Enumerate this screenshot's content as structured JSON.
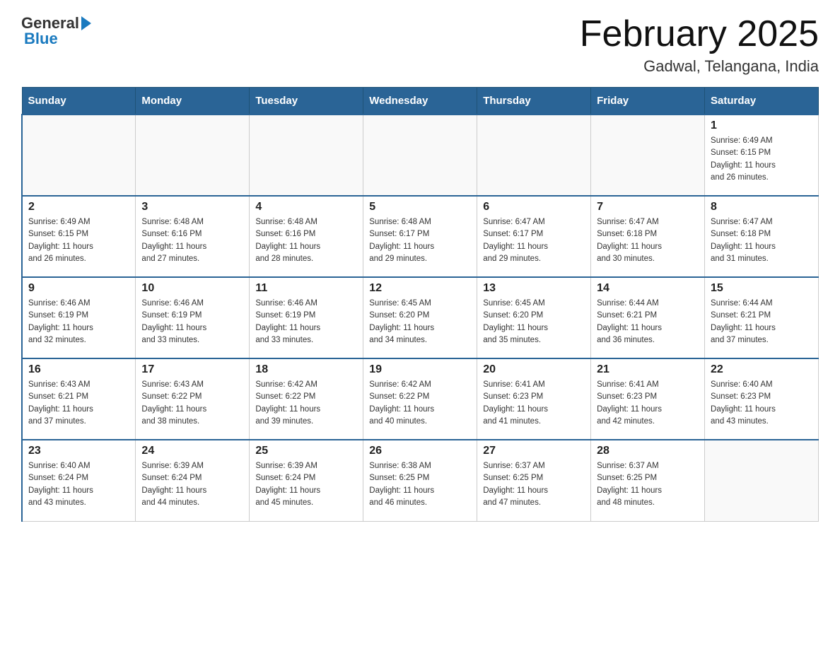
{
  "header": {
    "logo_general": "General",
    "logo_blue": "Blue",
    "month_title": "February 2025",
    "location": "Gadwal, Telangana, India"
  },
  "weekdays": [
    "Sunday",
    "Monday",
    "Tuesday",
    "Wednesday",
    "Thursday",
    "Friday",
    "Saturday"
  ],
  "weeks": [
    [
      {
        "day": "",
        "info": ""
      },
      {
        "day": "",
        "info": ""
      },
      {
        "day": "",
        "info": ""
      },
      {
        "day": "",
        "info": ""
      },
      {
        "day": "",
        "info": ""
      },
      {
        "day": "",
        "info": ""
      },
      {
        "day": "1",
        "info": "Sunrise: 6:49 AM\nSunset: 6:15 PM\nDaylight: 11 hours\nand 26 minutes."
      }
    ],
    [
      {
        "day": "2",
        "info": "Sunrise: 6:49 AM\nSunset: 6:15 PM\nDaylight: 11 hours\nand 26 minutes."
      },
      {
        "day": "3",
        "info": "Sunrise: 6:48 AM\nSunset: 6:16 PM\nDaylight: 11 hours\nand 27 minutes."
      },
      {
        "day": "4",
        "info": "Sunrise: 6:48 AM\nSunset: 6:16 PM\nDaylight: 11 hours\nand 28 minutes."
      },
      {
        "day": "5",
        "info": "Sunrise: 6:48 AM\nSunset: 6:17 PM\nDaylight: 11 hours\nand 29 minutes."
      },
      {
        "day": "6",
        "info": "Sunrise: 6:47 AM\nSunset: 6:17 PM\nDaylight: 11 hours\nand 29 minutes."
      },
      {
        "day": "7",
        "info": "Sunrise: 6:47 AM\nSunset: 6:18 PM\nDaylight: 11 hours\nand 30 minutes."
      },
      {
        "day": "8",
        "info": "Sunrise: 6:47 AM\nSunset: 6:18 PM\nDaylight: 11 hours\nand 31 minutes."
      }
    ],
    [
      {
        "day": "9",
        "info": "Sunrise: 6:46 AM\nSunset: 6:19 PM\nDaylight: 11 hours\nand 32 minutes."
      },
      {
        "day": "10",
        "info": "Sunrise: 6:46 AM\nSunset: 6:19 PM\nDaylight: 11 hours\nand 33 minutes."
      },
      {
        "day": "11",
        "info": "Sunrise: 6:46 AM\nSunset: 6:19 PM\nDaylight: 11 hours\nand 33 minutes."
      },
      {
        "day": "12",
        "info": "Sunrise: 6:45 AM\nSunset: 6:20 PM\nDaylight: 11 hours\nand 34 minutes."
      },
      {
        "day": "13",
        "info": "Sunrise: 6:45 AM\nSunset: 6:20 PM\nDaylight: 11 hours\nand 35 minutes."
      },
      {
        "day": "14",
        "info": "Sunrise: 6:44 AM\nSunset: 6:21 PM\nDaylight: 11 hours\nand 36 minutes."
      },
      {
        "day": "15",
        "info": "Sunrise: 6:44 AM\nSunset: 6:21 PM\nDaylight: 11 hours\nand 37 minutes."
      }
    ],
    [
      {
        "day": "16",
        "info": "Sunrise: 6:43 AM\nSunset: 6:21 PM\nDaylight: 11 hours\nand 37 minutes."
      },
      {
        "day": "17",
        "info": "Sunrise: 6:43 AM\nSunset: 6:22 PM\nDaylight: 11 hours\nand 38 minutes."
      },
      {
        "day": "18",
        "info": "Sunrise: 6:42 AM\nSunset: 6:22 PM\nDaylight: 11 hours\nand 39 minutes."
      },
      {
        "day": "19",
        "info": "Sunrise: 6:42 AM\nSunset: 6:22 PM\nDaylight: 11 hours\nand 40 minutes."
      },
      {
        "day": "20",
        "info": "Sunrise: 6:41 AM\nSunset: 6:23 PM\nDaylight: 11 hours\nand 41 minutes."
      },
      {
        "day": "21",
        "info": "Sunrise: 6:41 AM\nSunset: 6:23 PM\nDaylight: 11 hours\nand 42 minutes."
      },
      {
        "day": "22",
        "info": "Sunrise: 6:40 AM\nSunset: 6:23 PM\nDaylight: 11 hours\nand 43 minutes."
      }
    ],
    [
      {
        "day": "23",
        "info": "Sunrise: 6:40 AM\nSunset: 6:24 PM\nDaylight: 11 hours\nand 43 minutes."
      },
      {
        "day": "24",
        "info": "Sunrise: 6:39 AM\nSunset: 6:24 PM\nDaylight: 11 hours\nand 44 minutes."
      },
      {
        "day": "25",
        "info": "Sunrise: 6:39 AM\nSunset: 6:24 PM\nDaylight: 11 hours\nand 45 minutes."
      },
      {
        "day": "26",
        "info": "Sunrise: 6:38 AM\nSunset: 6:25 PM\nDaylight: 11 hours\nand 46 minutes."
      },
      {
        "day": "27",
        "info": "Sunrise: 6:37 AM\nSunset: 6:25 PM\nDaylight: 11 hours\nand 47 minutes."
      },
      {
        "day": "28",
        "info": "Sunrise: 6:37 AM\nSunset: 6:25 PM\nDaylight: 11 hours\nand 48 minutes."
      },
      {
        "day": "",
        "info": ""
      }
    ]
  ]
}
